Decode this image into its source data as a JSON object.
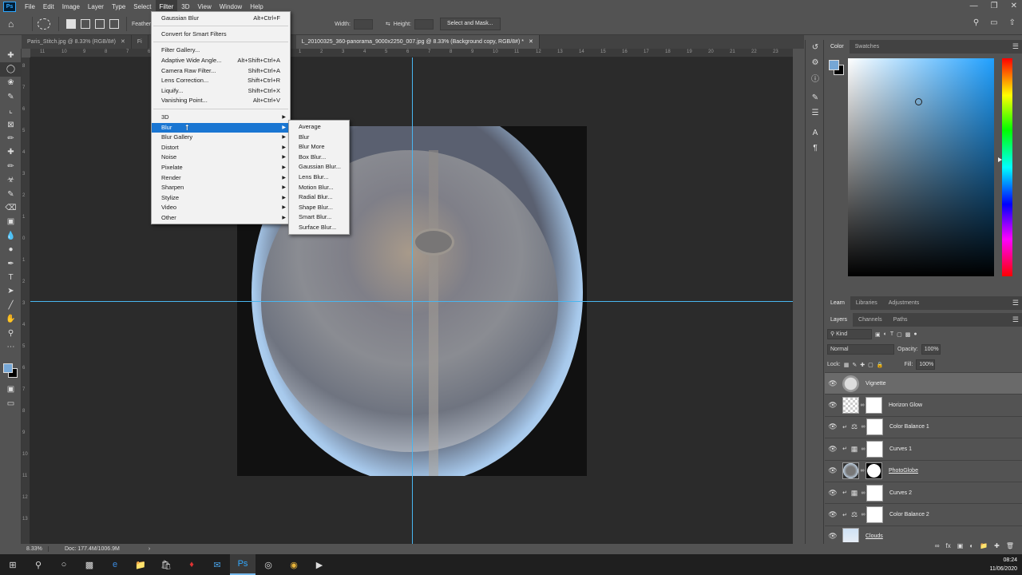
{
  "app": {
    "logo": "Ps"
  },
  "menubar": [
    "File",
    "Edit",
    "Image",
    "Layer",
    "Type",
    "Select",
    "Filter",
    "3D",
    "View",
    "Window",
    "Help"
  ],
  "options": {
    "feather_label": "Feather:",
    "width_label": "Width:",
    "height_label": "Height:",
    "select_mask": "Select and Mask..."
  },
  "tabs": [
    "Paris_Stitch.jpg @ 8.33% (RGB/8#)",
    "Fi",
    "L_20100325_360-panorama_9000x2250_007.jpg @ 8.33% (Background copy, RGB/8#) *"
  ],
  "ruler_h": [
    "11",
    "10",
    "9",
    "8",
    "7",
    "6",
    "5",
    "4",
    "3",
    "2",
    "1",
    "0",
    "1",
    "2",
    "3",
    "4",
    "5",
    "6",
    "7",
    "8",
    "9",
    "10",
    "11",
    "12",
    "13",
    "14",
    "15",
    "16",
    "17",
    "18",
    "19",
    "20",
    "21",
    "22",
    "23"
  ],
  "ruler_v": [
    "8",
    "7",
    "6",
    "5",
    "4",
    "3",
    "2",
    "1",
    "0",
    "1",
    "2",
    "3",
    "4",
    "5",
    "6",
    "7",
    "8",
    "9",
    "10",
    "11",
    "12",
    "13"
  ],
  "status": {
    "zoom": "8.33%",
    "doc": "Doc: 177.4M/1006.9M",
    "arrow": "›"
  },
  "filter_menu": {
    "top": [
      {
        "label": "Gaussian Blur",
        "shortcut": "Alt+Ctrl+F"
      },
      {
        "label": "Convert for Smart Filters",
        "shortcut": ""
      }
    ],
    "mid": [
      {
        "label": "Filter Gallery...",
        "shortcut": ""
      },
      {
        "label": "Adaptive Wide Angle...",
        "shortcut": "Alt+Shift+Ctrl+A"
      },
      {
        "label": "Camera Raw Filter...",
        "shortcut": "Shift+Ctrl+A"
      },
      {
        "label": "Lens Correction...",
        "shortcut": "Shift+Ctrl+R"
      },
      {
        "label": "Liquify...",
        "shortcut": "Shift+Ctrl+X"
      },
      {
        "label": "Vanishing Point...",
        "shortcut": "Alt+Ctrl+V"
      }
    ],
    "subs": [
      "3D",
      "Blur",
      "Blur Gallery",
      "Distort",
      "Noise",
      "Pixelate",
      "Render",
      "Sharpen",
      "Stylize",
      "Video",
      "Other"
    ],
    "highlighted": "Blur"
  },
  "blur_submenu": [
    "Average",
    "Blur",
    "Blur More",
    "Box Blur...",
    "Gaussian Blur...",
    "Lens Blur...",
    "Motion Blur...",
    "Radial Blur...",
    "Shape Blur...",
    "Smart Blur...",
    "Surface Blur..."
  ],
  "color_panel": {
    "tabs": [
      "Color",
      "Swatches"
    ],
    "foreground": "#76a7d6",
    "background": "#000000"
  },
  "learn_tabs": [
    "Learn",
    "Libraries",
    "Adjustments"
  ],
  "layers_tabs": [
    "Layers",
    "Channels",
    "Paths"
  ],
  "layers_ctrl": {
    "kind": "Kind",
    "blend": "Normal",
    "opacity_label": "Opacity:",
    "opacity": "100%",
    "lock_label": "Lock:",
    "fill_label": "Fill:",
    "fill": "100%"
  },
  "layers": [
    {
      "name": "Vignette",
      "selected": true
    },
    {
      "name": "Horizon Glow"
    },
    {
      "name": "Color Balance 1"
    },
    {
      "name": "Curves 1"
    },
    {
      "name": "PhotoGlobe"
    },
    {
      "name": "Curves 2"
    },
    {
      "name": "Color Balance 2"
    },
    {
      "name": "Clouds"
    }
  ],
  "taskbar": {
    "time": "08:24",
    "date": "11/06/2020"
  }
}
